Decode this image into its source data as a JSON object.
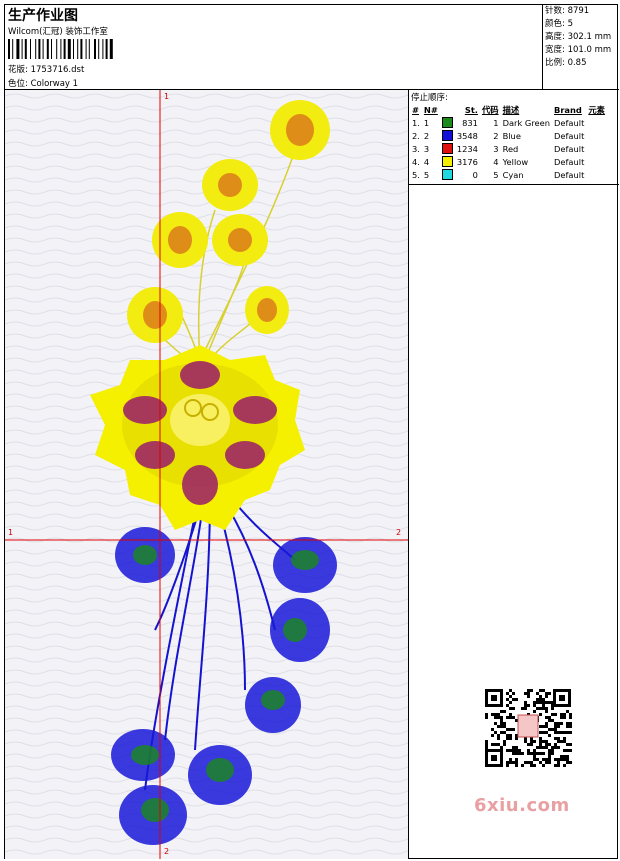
{
  "header": {
    "title": "生产作业图",
    "company": "Wilcom(汇冠) 装饰工作室",
    "design_label": "花版: 1753716.dst",
    "colorway_label": "色位: Colorway 1"
  },
  "stats": [
    "针数: 8791",
    "颜色: 5",
    "高度: 302.1 mm",
    "宽度: 101.0 mm",
    "比例: 0.85"
  ],
  "legend": {
    "stop_label": "停止顺序:",
    "headers": [
      "#",
      "N#",
      "St.",
      "代码",
      "描述",
      "Brand",
      "元素"
    ],
    "rows": [
      {
        "idx": "1.",
        "n": "1",
        "color": "#1a8a1a",
        "st": "831",
        "code": "1",
        "desc": "Dark Green",
        "brand": "Default"
      },
      {
        "idx": "2.",
        "n": "2",
        "color": "#1010d8",
        "st": "3548",
        "code": "2",
        "desc": "Blue",
        "brand": "Default"
      },
      {
        "idx": "3.",
        "n": "3",
        "color": "#e01010",
        "st": "1234",
        "code": "3",
        "desc": "Red",
        "brand": "Default"
      },
      {
        "idx": "4.",
        "n": "4",
        "color": "#f5f000",
        "st": "3176",
        "code": "4",
        "desc": "Yellow",
        "brand": "Default"
      },
      {
        "idx": "5.",
        "n": "5",
        "color": "#20d8e0",
        "st": "0",
        "code": "5",
        "desc": "Cyan",
        "brand": "Default"
      }
    ]
  },
  "axes": {
    "top": "1",
    "left": "1",
    "right": "2",
    "bottom": "2"
  },
  "watermark": "6xiu.com"
}
